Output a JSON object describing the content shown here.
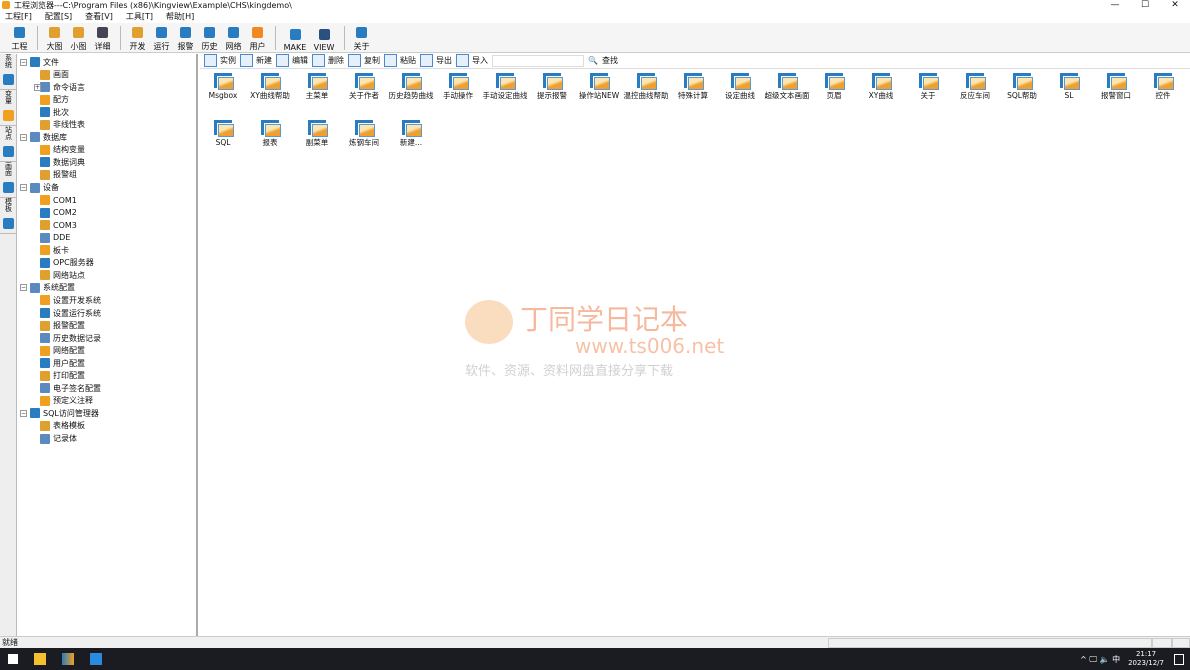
{
  "window": {
    "title": "工程浏览器---C:\\Program Files (x86)\\Kingview\\Example\\CHS\\kingdemo\\",
    "controls": [
      "—",
      "☐",
      "✕"
    ]
  },
  "menu": [
    "工程[F]",
    "配置[S]",
    "查看[V]",
    "工具[T]",
    "帮助[H]"
  ],
  "toolbar": [
    {
      "label": "工程",
      "icon": "tools-icon",
      "color": "#2a7cc0"
    },
    {
      "sep": true
    },
    {
      "label": "大图",
      "icon": "large-icon",
      "color": "#e0a030"
    },
    {
      "label": "小图",
      "icon": "small-icon",
      "color": "#e0a030"
    },
    {
      "label": "详细",
      "icon": "details-icon",
      "color": "#445"
    },
    {
      "sep": true
    },
    {
      "label": "开发",
      "icon": "develop-icon",
      "color": "#e0a030"
    },
    {
      "label": "运行",
      "icon": "run-icon",
      "color": "#2a7cc0"
    },
    {
      "label": "报警",
      "icon": "alarm-bell-icon",
      "color": "#2a7cc0"
    },
    {
      "label": "历史",
      "icon": "history-clock-icon",
      "color": "#2a7cc0"
    },
    {
      "label": "网络",
      "icon": "network-globe-icon",
      "color": "#2a7cc0"
    },
    {
      "label": "用户",
      "icon": "user-icon",
      "color": "#f08a20"
    },
    {
      "sep": true
    },
    {
      "label": "MAKE",
      "icon": "make-icon",
      "color": "#2a7cc0"
    },
    {
      "label": "VIEW",
      "icon": "view-eye-icon",
      "color": "#2a5080"
    },
    {
      "sep": true
    },
    {
      "label": "关于",
      "icon": "about-book-icon",
      "color": "#2a7cc0"
    }
  ],
  "side_tabs": [
    "系统",
    "变量",
    "站点",
    "画面",
    "模板"
  ],
  "tree": [
    {
      "label": "文件",
      "level": 0,
      "exp": "−"
    },
    {
      "label": "画面",
      "level": 1
    },
    {
      "label": "命令语言",
      "level": 1,
      "exp": "+"
    },
    {
      "label": "配方",
      "level": 1
    },
    {
      "label": "批次",
      "level": 1
    },
    {
      "label": "非线性表",
      "level": 1
    },
    {
      "label": "数据库",
      "level": 0,
      "exp": "−"
    },
    {
      "label": "结构变量",
      "level": 1
    },
    {
      "label": "数据词典",
      "level": 1
    },
    {
      "label": "报警组",
      "level": 1
    },
    {
      "label": "设备",
      "level": 0,
      "exp": "−"
    },
    {
      "label": "COM1",
      "level": 1
    },
    {
      "label": "COM2",
      "level": 1
    },
    {
      "label": "COM3",
      "level": 1
    },
    {
      "label": "DDE",
      "level": 1
    },
    {
      "label": "板卡",
      "level": 1
    },
    {
      "label": "OPC服务器",
      "level": 1
    },
    {
      "label": "网络站点",
      "level": 1
    },
    {
      "label": "系统配置",
      "level": 0,
      "exp": "−"
    },
    {
      "label": "设置开发系统",
      "level": 1
    },
    {
      "label": "设置运行系统",
      "level": 1
    },
    {
      "label": "报警配置",
      "level": 1
    },
    {
      "label": "历史数据记录",
      "level": 1
    },
    {
      "label": "网络配置",
      "level": 1
    },
    {
      "label": "用户配置",
      "level": 1
    },
    {
      "label": "打印配置",
      "level": 1
    },
    {
      "label": "电子签名配置",
      "level": 1
    },
    {
      "label": "预定义注释",
      "level": 1
    },
    {
      "label": "SQL访问管理器",
      "level": 0,
      "exp": "−"
    },
    {
      "label": "表格模板",
      "level": 1
    },
    {
      "label": "记录体",
      "level": 1
    }
  ],
  "content_toolbar": {
    "buttons": [
      "实例",
      "新建",
      "编辑",
      "删除",
      "复制",
      "粘贴",
      "导出",
      "导入"
    ],
    "search_value": "",
    "search_label": "查找"
  },
  "items": [
    "Msgbox",
    "XY曲线帮助",
    "主菜单",
    "关于作者",
    "历史趋势曲线",
    "手动操作",
    "手动设定曲线",
    "提示报警",
    "操作站NEW",
    "温控曲线帮助",
    "特殊计算",
    "设定曲线",
    "超级文本画面",
    "页眉",
    "XY曲线",
    "关于",
    "反应车间",
    "SQL帮助",
    "SL",
    "报警窗口",
    "控件",
    "SQL",
    "报表",
    "副菜单",
    "炼钢车间",
    "新建..."
  ],
  "status": "就绪",
  "taskbar": {
    "tray": "^ 🖵 🔈 中",
    "time": "21:17",
    "date": "2023/12/7"
  },
  "watermark": {
    "title": "丁同学日记本",
    "url": "www.ts006.net",
    "slogan": "软件、资源、资料网盘直接分享下载"
  }
}
